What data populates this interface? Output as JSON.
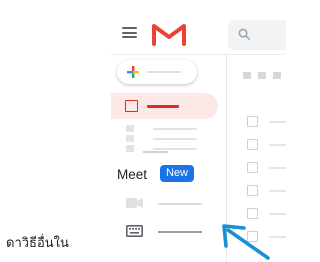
{
  "caption": "ดาวิธีอื่นใน",
  "sidebar": {
    "meet_label": "Meet",
    "new_badge": "New"
  },
  "colors": {
    "accent_blue": "#1a73e8",
    "gmail_red": "#ea4335",
    "inbox_highlight": "#fce8e6"
  },
  "icons": [
    "menu-icon",
    "gmail-logo",
    "search-icon",
    "compose-plus-icon",
    "inbox-icon",
    "video-camera-icon",
    "keyboard-icon",
    "pointer-arrow"
  ]
}
